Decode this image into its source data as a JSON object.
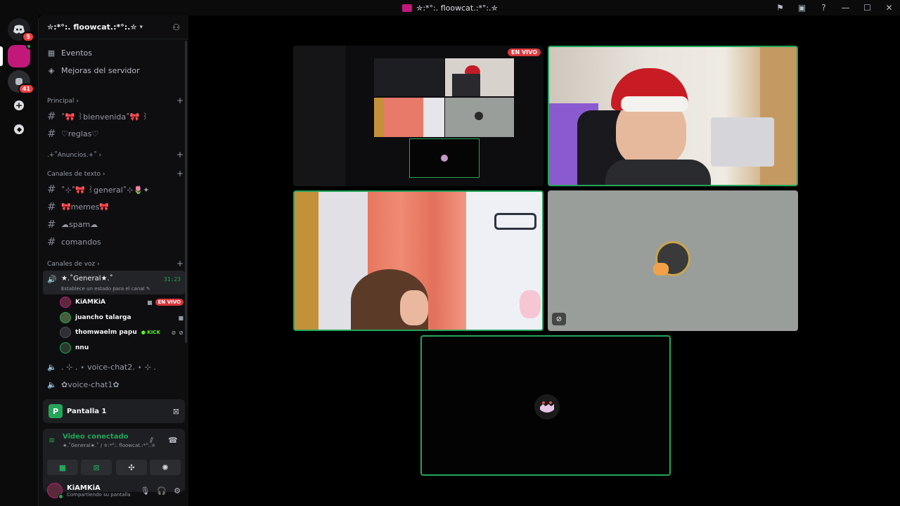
{
  "window": {
    "title": "✮:*°:. floowcat.:*°:.✮",
    "controls": [
      "⚑",
      "▣",
      "?",
      "—",
      "☐",
      "✕"
    ]
  },
  "rail": {
    "badges": {
      "home": "5",
      "server2": "41"
    }
  },
  "server": {
    "name": "✮:*°:. floowcat.:*°:.✮"
  },
  "nav": {
    "events": "Eventos",
    "boosts": "Mejoras del servidor"
  },
  "categories": {
    "principal": "Principal",
    "anuncios": ".+˚Anuncios.+˚",
    "text": "Canales de texto",
    "voice": "Canales de voz"
  },
  "channels": {
    "principal": [
      "˚🎀 ꒱bienvenida˚🎀 ꒱",
      "♡reglas♡"
    ],
    "text": [
      "˚⊹˚🎀 ꒱general˚⊹🌷✦",
      "🎀memes🎀",
      "☁spam☁",
      "comandos"
    ]
  },
  "voice": {
    "active_channel": "★.˚General★.˚",
    "timer": "31:23",
    "status_placeholder": "Establece un estado para el canal",
    "users": [
      {
        "name": "KiAMKiA",
        "badge": "EN VIVO"
      },
      {
        "name": "juancho talarga",
        "badge": ""
      },
      {
        "name": "thomwaelm papu",
        "badge": "KICK"
      },
      {
        "name": "nnu",
        "badge": ""
      }
    ],
    "other_channels": [
      ". ⊹ . ⋆ voice-chat2. ⋆ ⊹ .",
      "✿voice-chat1✿"
    ]
  },
  "screen_share": {
    "label": "Pantalla 1",
    "icon_letter": "P"
  },
  "rtc": {
    "status": "Video conectado",
    "location": "★.˚General★.˚ / ✮:*°:. floowcat.:*°:.✮"
  },
  "user": {
    "name": "KiAMKiA",
    "status": "Compartiendo su pantalla"
  },
  "stage": {
    "live_badge": "EN VIVO"
  },
  "colors": {
    "speaking": "#23a55a",
    "live": "#da373c",
    "brand": "#c2187a"
  }
}
